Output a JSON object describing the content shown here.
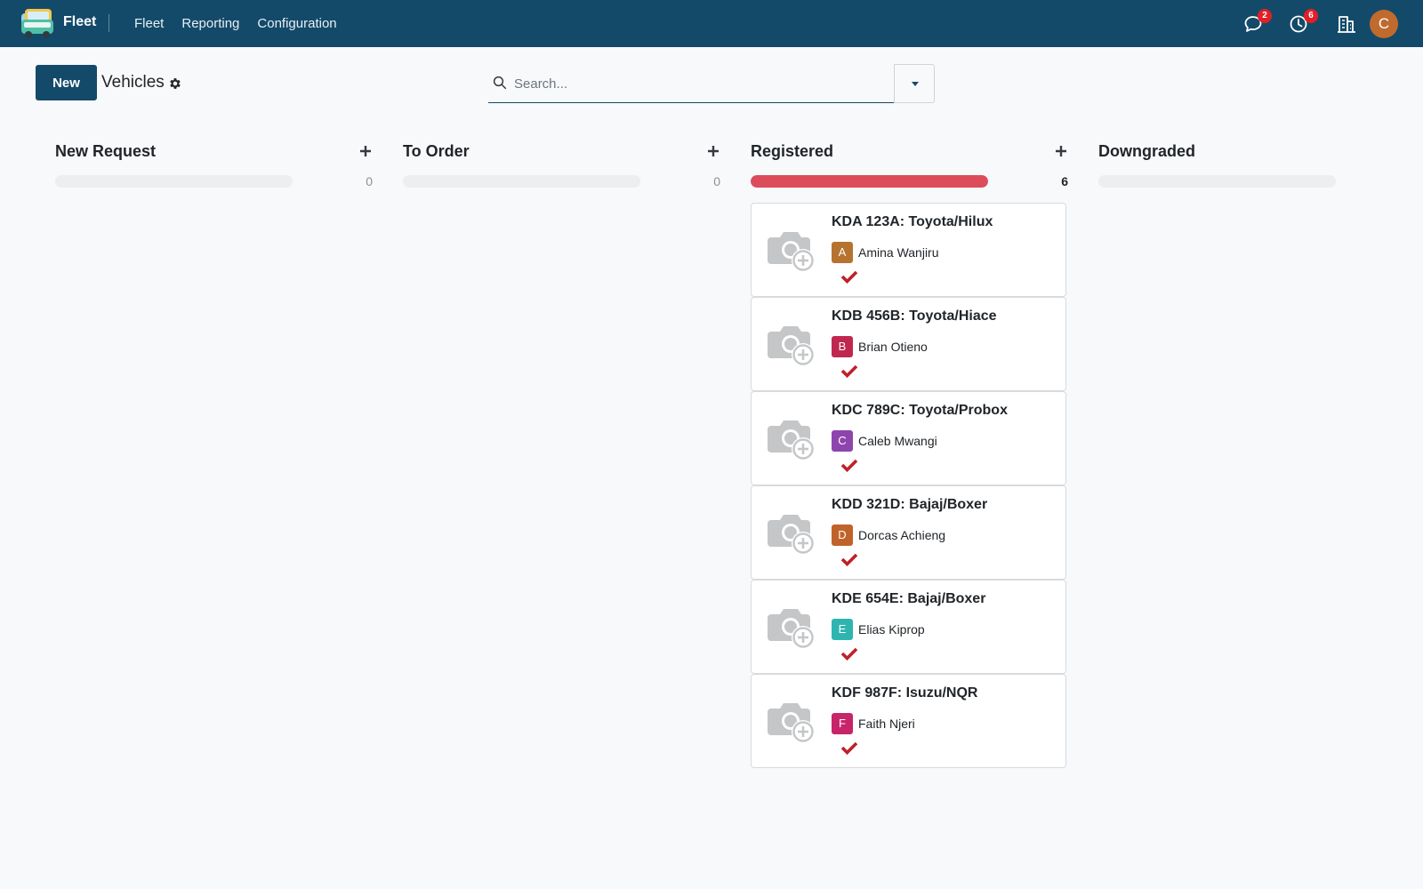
{
  "navbar": {
    "app_name": "Fleet",
    "menu": [
      "Fleet",
      "Reporting",
      "Configuration"
    ],
    "messages_count": "2",
    "activities_count": "6",
    "user_initial": "C",
    "color": "#134a6a"
  },
  "control": {
    "new_label": "New",
    "title": "Vehicles",
    "search_placeholder": "Search..."
  },
  "columns": [
    {
      "title": "New Request",
      "count": "0",
      "progress": 0
    },
    {
      "title": "To Order",
      "count": "0",
      "progress": 0
    },
    {
      "title": "Registered",
      "count": "6",
      "progress": 1
    },
    {
      "title": "Downgraded",
      "count": "",
      "progress": 0
    }
  ],
  "cards": [
    {
      "plate": "KDA 123A",
      "model": "Toyota/Hilux",
      "driver": "Amina Wanjiru",
      "initial": "A",
      "color": "#b5732e"
    },
    {
      "plate": "KDB 456B",
      "model": "Toyota/Hiace",
      "driver": "Brian Otieno",
      "initial": "B",
      "color": "#c0274f"
    },
    {
      "plate": "KDC 789C",
      "model": "Toyota/Probox",
      "driver": "Caleb Mwangi",
      "initial": "C",
      "color": "#8e44ad"
    },
    {
      "plate": "KDD 321D",
      "model": "Bajaj/Boxer",
      "driver": "Dorcas Achieng",
      "initial": "D",
      "color": "#c0632a"
    },
    {
      "plate": "KDE 654E",
      "model": "Bajaj/Boxer",
      "driver": "Elias Kiprop",
      "initial": "E",
      "color": "#2fb5b0"
    },
    {
      "plate": "KDF 987F",
      "model": "Isuzu/NQR",
      "driver": "Faith Njeri",
      "initial": "F",
      "color": "#c8246a"
    }
  ],
  "colors": {
    "progress_fill": "#dc4c5a",
    "check": "#c0202a"
  }
}
